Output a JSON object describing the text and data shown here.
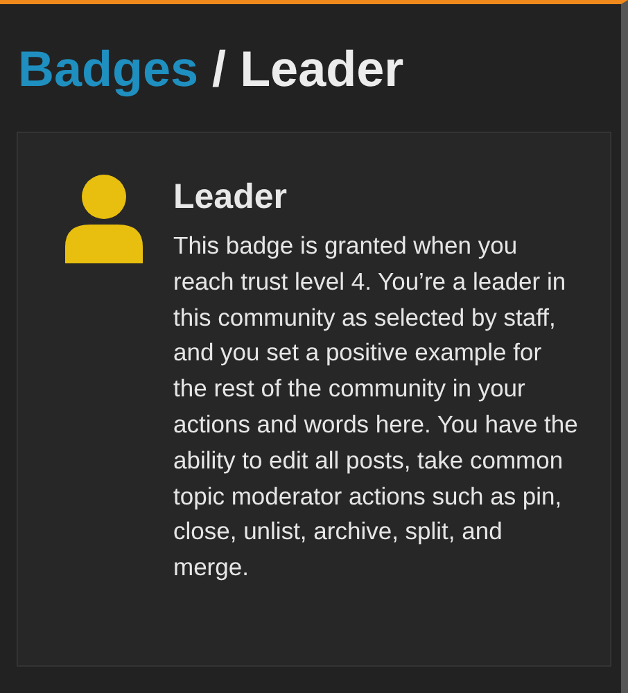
{
  "breadcrumb": {
    "parent": "Badges",
    "separator": "/",
    "current": "Leader"
  },
  "badge": {
    "name": "Leader",
    "description": "This badge is granted when you reach trust level 4. You’re a leader in this community as selected by staff, and you set a positive example for the rest of the community in your actions and words here. You have the ability to edit all posts, take common topic moderator actions such as pin, close, unlist, archive, split, and merge."
  }
}
